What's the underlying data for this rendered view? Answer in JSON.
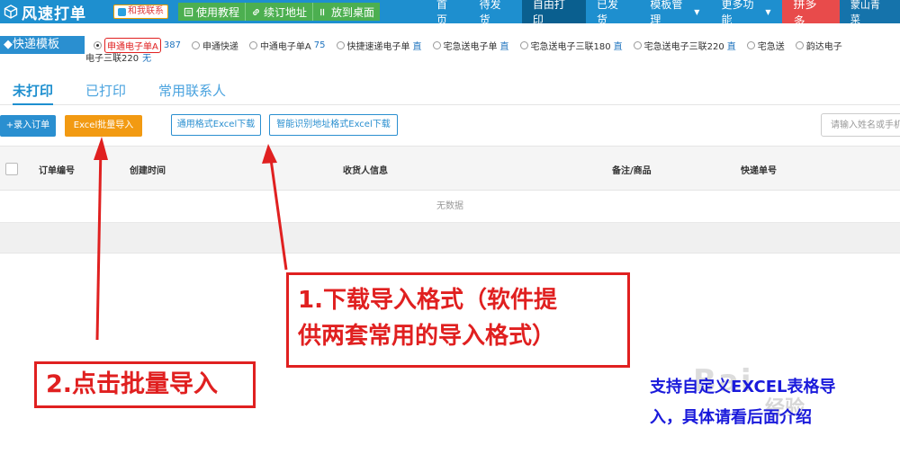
{
  "app": {
    "logo_text": "风速打单",
    "contact_label": "和我联系",
    "top_links": [
      {
        "label": "使用教程",
        "icon": "book-icon"
      },
      {
        "label": "续订地址",
        "icon": "link-icon"
      },
      {
        "label": "放到桌面",
        "icon": "desktop-icon"
      }
    ]
  },
  "nav": {
    "items": [
      {
        "label": "首页"
      },
      {
        "label": "待发货"
      },
      {
        "label": "自由打印",
        "active": true
      },
      {
        "label": "已发货"
      },
      {
        "label": "模板管理",
        "dropdown": true
      },
      {
        "label": "更多功能",
        "dropdown": true
      }
    ],
    "pdd_label": "拼多多",
    "user_label": "蒙山青菜"
  },
  "templates": {
    "tag_label": "快递模板",
    "options": [
      {
        "name": "申通电子单A",
        "count": "387",
        "selected": true
      },
      {
        "name": "申通快递",
        "count": ""
      },
      {
        "name": "中通电子单A",
        "count": "75"
      },
      {
        "name": "快捷速递电子单",
        "count": "直"
      },
      {
        "name": "宅急送电子单",
        "count": "直"
      },
      {
        "name": "宅急送电子三联180",
        "count": "直"
      },
      {
        "name": "宅急送电子三联220",
        "count": "直"
      },
      {
        "name": "宅急送",
        "count": ""
      },
      {
        "name": "韵达电子",
        "count": ""
      }
    ],
    "wrap_text": "电子三联220",
    "wrap_count": "无"
  },
  "tabs": [
    {
      "label": "未打印",
      "active": true
    },
    {
      "label": "已打印"
    },
    {
      "label": "常用联系人"
    }
  ],
  "toolbar": {
    "entry_label": "+录入订单",
    "excel_label": "Excel批量导入",
    "download_general": "通用格式Excel下载",
    "download_smart": "智能识别地址格式Excel下载",
    "search_placeholder": "请输入姓名或手机"
  },
  "table": {
    "columns": [
      "订单编号",
      "创建时间",
      "收货人信息",
      "备注/商品",
      "快递单号"
    ],
    "empty_text": "无数据"
  },
  "annotations": {
    "note1_line1": "1.下载导入格式（软件提",
    "note1_line2": "供两套常用的导入格式）",
    "note2": "2.点击批量导入",
    "note3_line1": "支持自定义EXCEL表格导",
    "note3_line2": "入，具体请看后面介绍"
  },
  "watermark": {
    "brand": "Bai",
    "sub": "经验"
  },
  "colors": {
    "topbar": "#1e8fcf",
    "nav_active": "#0a5f8f",
    "link_group": "#4caf50",
    "pdd": "#e84b4b",
    "excel_button": "#f29a12",
    "annotation_red": "#e02020",
    "annotation_blue": "#1a1adb"
  }
}
